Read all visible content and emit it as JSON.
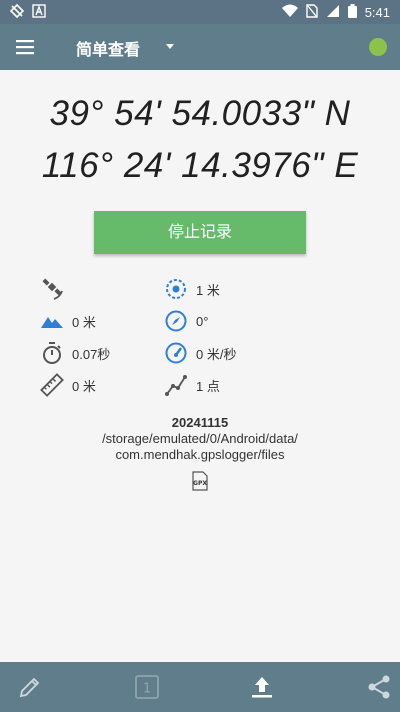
{
  "status_bar": {
    "time": "5:41",
    "icons": [
      "no-gps-icon",
      "notification-a-icon",
      "wifi-icon",
      "no-sim-icon",
      "signal-icon",
      "battery-icon"
    ]
  },
  "app_bar": {
    "title": "简单查看",
    "status_color": "#8bc34a"
  },
  "coordinates": {
    "latitude": "39° 54' 54.0033\" N",
    "longitude": "116° 24' 14.3976\" E"
  },
  "stop_button_label": "停止记录",
  "stats": {
    "satellites": "",
    "accuracy": "1 米",
    "altitude": "0 米",
    "direction": "0°",
    "duration": "0.07秒",
    "speed": "0 米/秒",
    "distance": "0 米",
    "points": "1 点"
  },
  "file": {
    "name": "20241115",
    "path_line1": "/storage/emulated/0/Android/data/",
    "path_line2": "com.mendhak.gpslogger/files",
    "format_icon_label": "GPX"
  },
  "bottom_bar": {
    "page_number": "1",
    "buttons": [
      "pencil-icon",
      "page-number-icon",
      "upload-icon",
      "share-icon"
    ]
  },
  "colors": {
    "app_bar": "#607d8b",
    "status_bar": "#5b7385",
    "accent_green": "#66bb6a",
    "icon_blue": "#2f7fd6",
    "status_dot": "#8bc34a"
  }
}
